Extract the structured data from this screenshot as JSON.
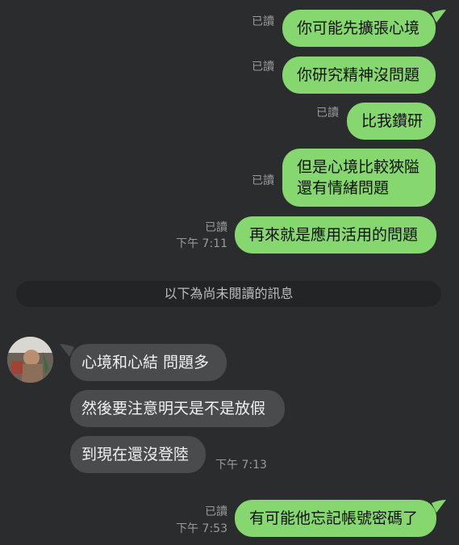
{
  "colors": {
    "background": "#2b2c2e",
    "outgoing": "#86d76f",
    "incoming": "#4a4b4d",
    "meta": "#9a9a9a"
  },
  "messages_out_1": [
    {
      "text": "你可能先擴張心境",
      "read": "已讀"
    },
    {
      "text": "你研究精神沒問題",
      "read": "已讀"
    },
    {
      "text": "比我鑽研",
      "read": "已讀"
    },
    {
      "text_line1": "但是心境比較狹隘",
      "text_line2": "還有情緒問題",
      "read": "已讀"
    },
    {
      "text": "再來就是應用活用的問題",
      "read": "已讀",
      "time": "下午 7:11"
    }
  ],
  "divider": "以下為尚未閱讀的訊息",
  "contact": {
    "avatar_icon": "contact-avatar-photo"
  },
  "messages_in": [
    {
      "text": "心境和心結 問題多"
    },
    {
      "text": "然後要注意明天是不是放假"
    },
    {
      "text": "到現在還沒登陸",
      "time": "下午 7:13"
    }
  ],
  "messages_out_2": [
    {
      "text": "有可能他忘記帳號密碼了",
      "read": "已讀",
      "time": "下午 7:53"
    }
  ]
}
